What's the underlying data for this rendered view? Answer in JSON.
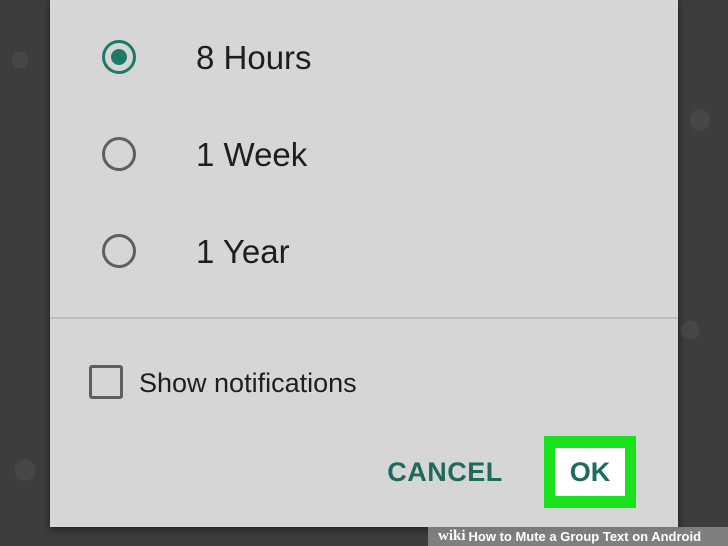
{
  "mute_dialog": {
    "options": [
      {
        "label": "8 Hours",
        "checked": true
      },
      {
        "label": "1 Week",
        "checked": false
      },
      {
        "label": "1 Year",
        "checked": false
      }
    ],
    "show_notifications": {
      "label": "Show notifications",
      "checked": false
    },
    "cancel_label": "CANCEL",
    "ok_label": "OK"
  },
  "colors": {
    "accent": "#1d7a66",
    "highlight": "#19e11a",
    "dialog_bg": "#d6d6d6"
  },
  "watermark": {
    "brand": "wiki",
    "text": "How to Mute a Group Text on Android"
  }
}
